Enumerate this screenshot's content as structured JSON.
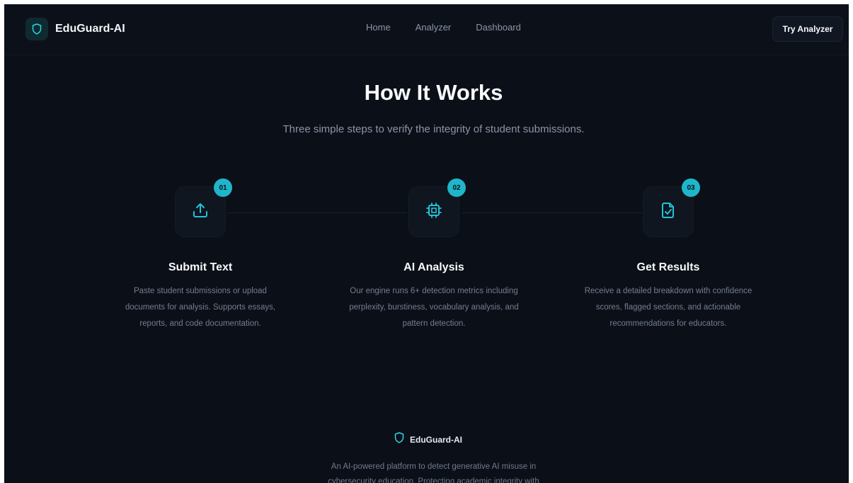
{
  "brand": {
    "name": "EduGuard-AI",
    "icon": "shield-icon"
  },
  "nav": {
    "links": [
      "Home",
      "Analyzer",
      "Dashboard"
    ],
    "cta_label": "Try Analyzer"
  },
  "hero": {
    "title": "How It Works",
    "subtitle": "Three simple steps to verify the integrity of student submissions."
  },
  "steps": [
    {
      "number": "01",
      "icon": "upload-icon",
      "title": "Submit Text",
      "desc_lines": [
        "Paste student submissions or upload",
        "documents for analysis. Supports essays,",
        "reports, and code documentation."
      ]
    },
    {
      "number": "02",
      "icon": "cpu-chip-icon",
      "title": "AI Analysis",
      "desc_lines": [
        "Our engine runs 6+ detection metrics including",
        "perplexity, burstiness, vocabulary analysis, and",
        "pattern detection."
      ]
    },
    {
      "number": "03",
      "icon": "file-check-icon",
      "title": "Get Results",
      "desc_lines": [
        "Receive a detailed breakdown with confidence",
        "scores, flagged sections, and actionable",
        "recommendations for educators."
      ]
    }
  ],
  "footer": {
    "brand_name": "EduGuard-AI",
    "desc_lines": [
      "An AI-powered platform to detect generative AI misuse in",
      "cybersecurity education. Protecting academic integrity with"
    ]
  },
  "colors": {
    "accent": "#1fb6cc",
    "background": "#0b0f17",
    "text": "#f8fafc",
    "muted": "#8a95a8"
  }
}
